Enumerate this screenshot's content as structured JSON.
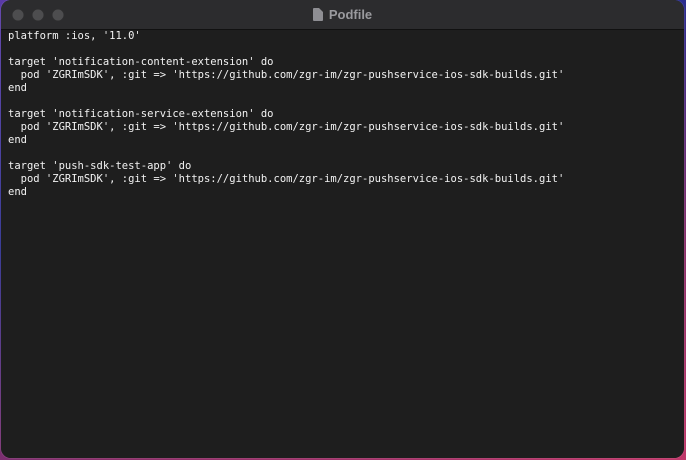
{
  "window": {
    "title": "Podfile",
    "icon": "document-icon"
  },
  "editor": {
    "lines": [
      "platform :ios, '11.0'",
      "",
      "target 'notification-content-extension' do",
      "  pod 'ZGRImSDK', :git => 'https://github.com/zgr-im/zgr-pushservice-ios-sdk-builds.git'",
      "end",
      "",
      "target 'notification-service-extension' do",
      "  pod 'ZGRImSDK', :git => 'https://github.com/zgr-im/zgr-pushservice-ios-sdk-builds.git'",
      "end",
      "",
      "target 'push-sdk-test-app' do",
      "  pod 'ZGRImSDK', :git => 'https://github.com/zgr-im/zgr-pushservice-ios-sdk-builds.git'",
      "end"
    ]
  }
}
